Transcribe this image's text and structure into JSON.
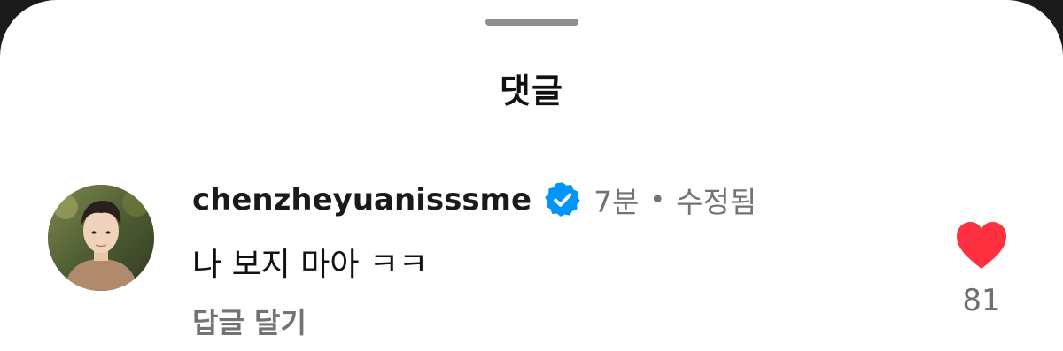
{
  "sheet": {
    "title": "댓글"
  },
  "comment": {
    "username": "chenzheyuanisssme",
    "verified": true,
    "time": "7분",
    "separator": "•",
    "edited_label": "수정됨",
    "text": "나 보지 마아 ㅋㅋ",
    "reply_label": "답글 달기",
    "like_count": "81",
    "liked": true
  },
  "colors": {
    "like_heart": "#ff3040",
    "verified_badge": "#0095f6",
    "secondary_text": "#737373"
  },
  "icons": {
    "verified": "verified-badge-icon",
    "like": "heart-filled-icon"
  }
}
